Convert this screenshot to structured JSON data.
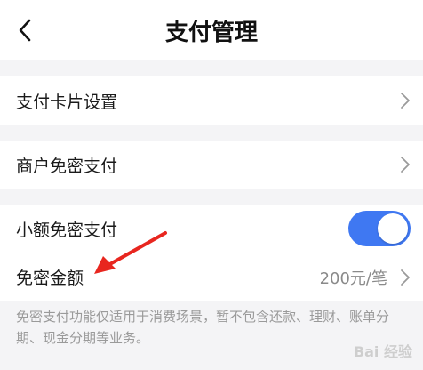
{
  "header": {
    "title": "支付管理",
    "back_icon": "chevron-left-icon"
  },
  "groups": [
    {
      "items": [
        {
          "label": "支付卡片设置",
          "control": "chevron"
        }
      ]
    },
    {
      "items": [
        {
          "label": "商户免密支付",
          "control": "chevron"
        }
      ]
    },
    {
      "items": [
        {
          "label": "小额免密支付",
          "control": "toggle",
          "toggle_on": true
        },
        {
          "label": "免密金额",
          "control": "chevron",
          "value": "200元/笔"
        }
      ]
    }
  ],
  "note": "免密支付功能仅适用于消费场景，暂不包含还款、理财、账单分期、现金分期等业务。",
  "annotation": {
    "type": "arrow",
    "color": "#e8261f"
  },
  "watermark": "Bai 经验",
  "colors": {
    "toggle_on": "#3f78f2",
    "background": "#f4f4f6",
    "arrow": "#e8261f"
  }
}
